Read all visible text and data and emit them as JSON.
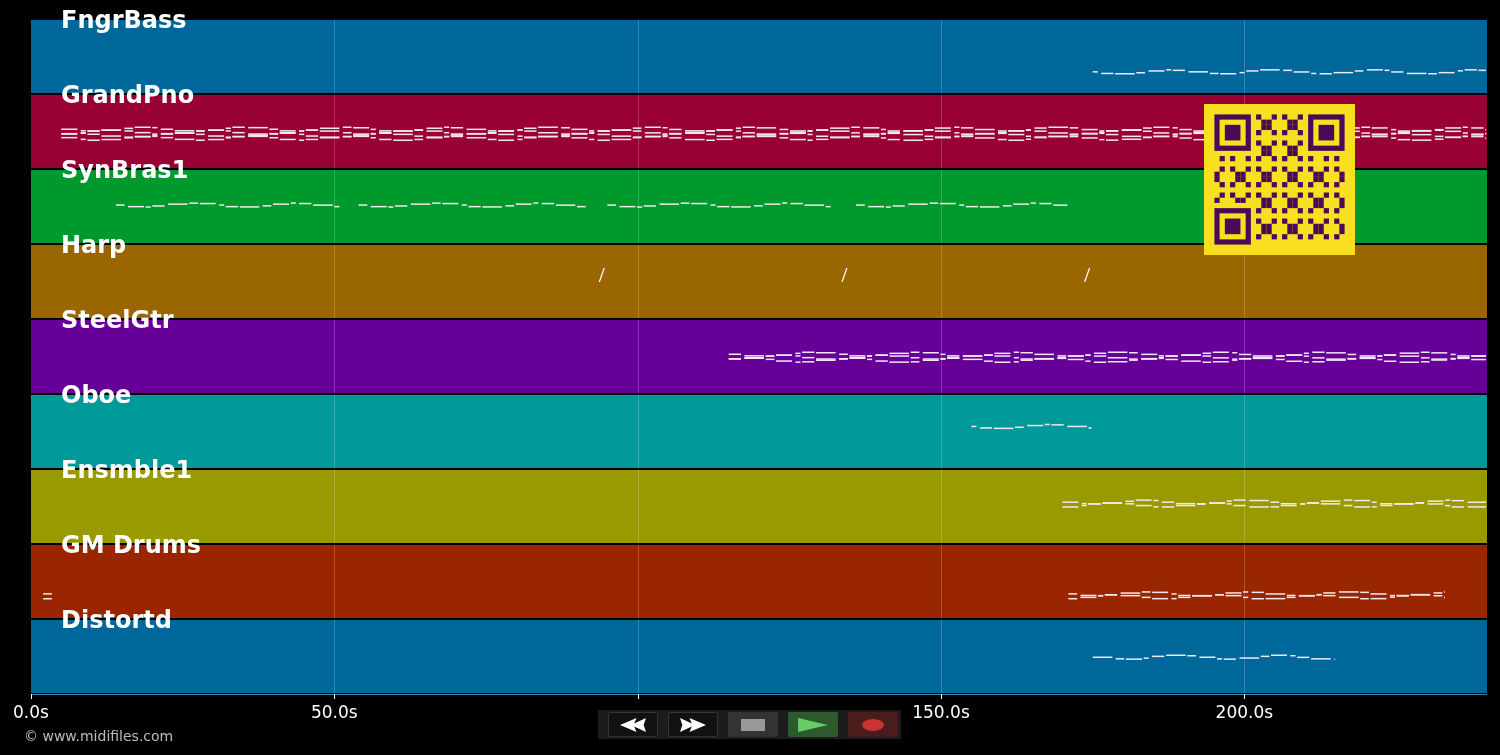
{
  "tracks": [
    {
      "name": "FngrBass",
      "color": "#00679a"
    },
    {
      "name": "GrandPno",
      "color": "#990033"
    },
    {
      "name": "SynBras1",
      "color": "#00992b"
    },
    {
      "name": "Harp",
      "color": "#996600"
    },
    {
      "name": "SteelGtr",
      "color": "#660099"
    },
    {
      "name": "Oboe",
      "color": "#009999"
    },
    {
      "name": "Ensmble1",
      "color": "#999900"
    },
    {
      "name": "GM Drums",
      "color": "#992600"
    },
    {
      "name": "Distortd",
      "color": "#00679a"
    }
  ],
  "time_axis": {
    "ticks": [
      "0.0s",
      "50.0s",
      "150.0s",
      "200.0s"
    ]
  },
  "transport": [
    {
      "kind": "rewind"
    },
    {
      "kind": "forward"
    },
    {
      "kind": "stop"
    },
    {
      "kind": "play"
    },
    {
      "kind": "record"
    }
  ],
  "copyright": "© www.midifiles.com"
}
